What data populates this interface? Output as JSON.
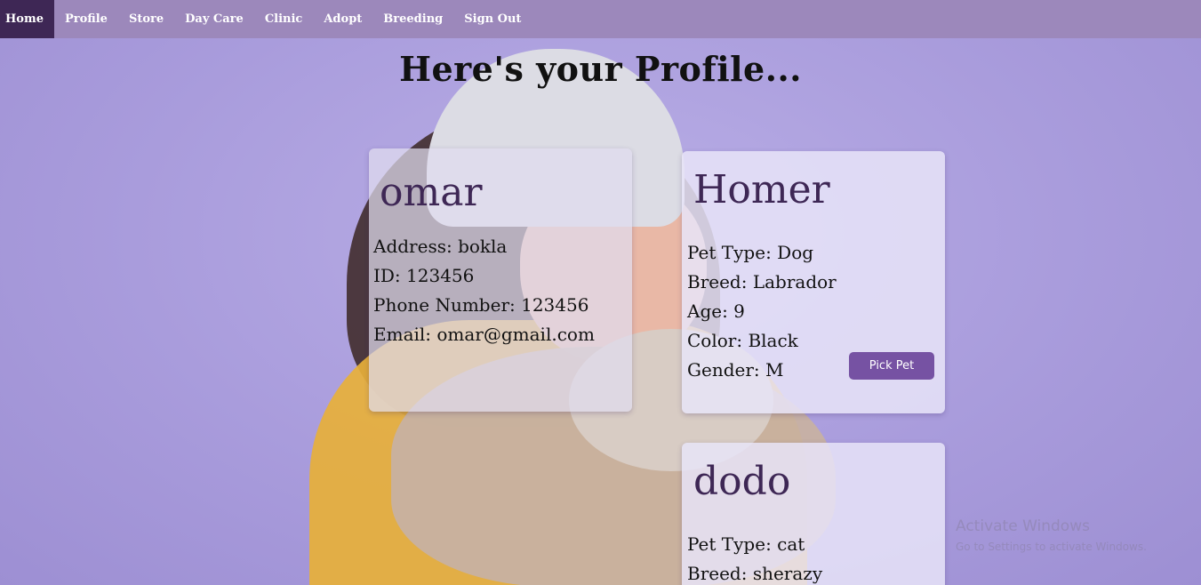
{
  "nav": {
    "items": [
      "Home",
      "Profile",
      "Store",
      "Day Care",
      "Clinic",
      "Adopt",
      "Breeding",
      "Sign Out"
    ],
    "active": "Home"
  },
  "page": {
    "title": "Here's your Profile..."
  },
  "user": {
    "name": "omar",
    "address": "Address: bokla",
    "id": "ID: 123456",
    "phone": "Phone Number: 123456",
    "email": "Email: omar@gmail.com"
  },
  "pets": [
    {
      "name": "Homer",
      "type": "Pet Type: Dog",
      "breed": "Breed: Labrador",
      "age": "Age: 9",
      "color": "Color: Black",
      "gender": "Gender: M",
      "button": "Pick Pet"
    },
    {
      "name": "dodo",
      "type": "Pet Type: cat",
      "breed": "Breed: sherazy"
    }
  ],
  "watermark": {
    "title": "Activate Windows",
    "subtitle": "Go to Settings to activate Windows."
  },
  "colors": {
    "nav_bg": "#9c88bb",
    "nav_active": "#3e2755",
    "accent": "#7652a3",
    "page_bg": "#ac9fdd"
  }
}
